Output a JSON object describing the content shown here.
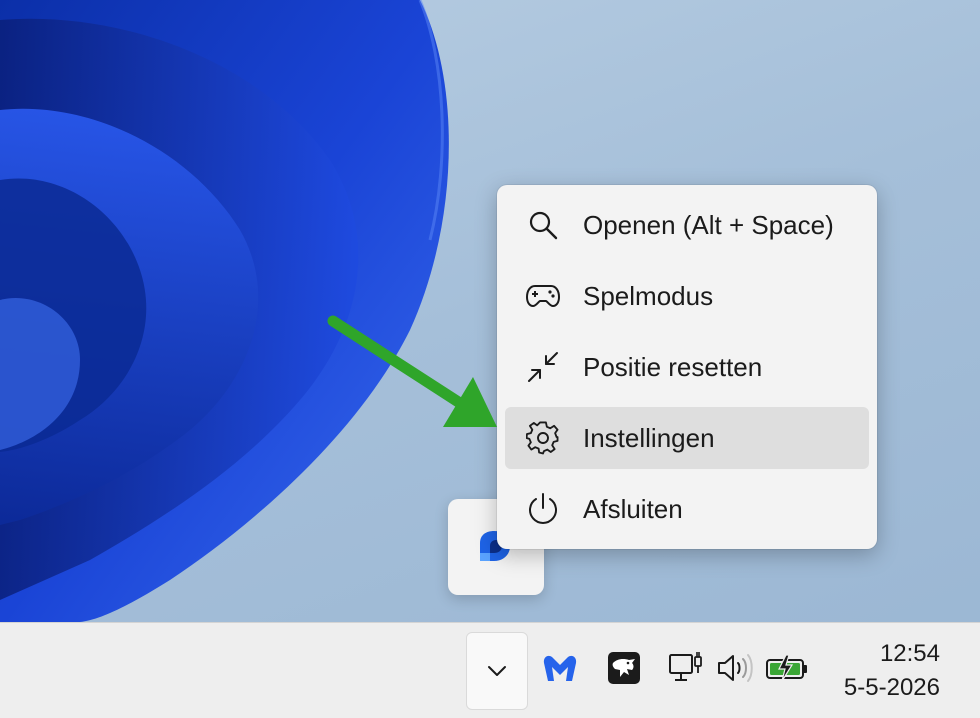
{
  "context_menu": {
    "items": [
      {
        "label": "Openen (Alt + Space)",
        "icon": "search-icon"
      },
      {
        "label": "Spelmodus",
        "icon": "gamepad-icon"
      },
      {
        "label": "Positie resetten",
        "icon": "collapse-arrows-icon"
      },
      {
        "label": "Instellingen",
        "icon": "gear-icon",
        "highlighted": true
      },
      {
        "label": "Afsluiten",
        "icon": "power-icon"
      }
    ]
  },
  "popup_tile": {
    "icon": "app-launcher-icon"
  },
  "annotation": {
    "icon": "green-arrow-icon",
    "color": "#2fa52a"
  },
  "taskbar": {
    "tray": [
      {
        "icon": "chevron-down-icon"
      },
      {
        "icon": "malwarebytes-icon",
        "color": "#2563eb"
      },
      {
        "icon": "eagle-app-icon"
      },
      {
        "icon": "network-icon"
      },
      {
        "icon": "speaker-icon"
      },
      {
        "icon": "battery-charging-icon",
        "color": "#3aa635"
      }
    ],
    "clock": {
      "time": "12:54",
      "date": "5-5-2026"
    }
  },
  "colors": {
    "wallpaper_blue": "#1a3fd0",
    "desktop_bg": "#a9c2dc",
    "menu_bg": "#f3f3f3",
    "highlight": "#dedede"
  }
}
